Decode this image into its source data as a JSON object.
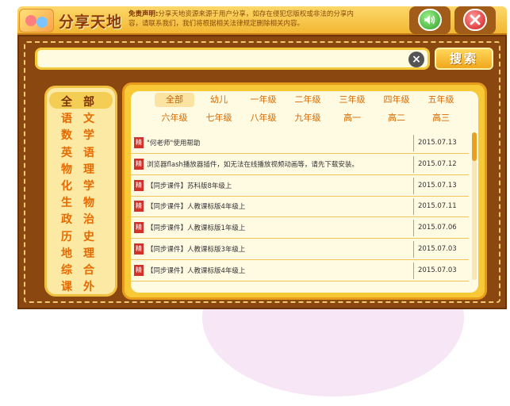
{
  "header": {
    "title": "分享天地",
    "disclaimer_label": "免责声明:",
    "disclaimer_text": "分享天地资源来源于用户分享，如存在侵犯您版权或非法的分享内容，请联系我们，我们将根据相关法律规定删除相关内容。"
  },
  "search": {
    "value": "",
    "button_label": "搜索"
  },
  "subjects": [
    [
      "全",
      "部"
    ],
    [
      "语",
      "文"
    ],
    [
      "数",
      "学"
    ],
    [
      "英",
      "语"
    ],
    [
      "物",
      "理"
    ],
    [
      "化",
      "学"
    ],
    [
      "生",
      "物"
    ],
    [
      "政",
      "治"
    ],
    [
      "历",
      "史"
    ],
    [
      "地",
      "理"
    ],
    [
      "综",
      "合"
    ],
    [
      "课",
      "外"
    ]
  ],
  "grades": [
    "全部",
    "幼儿",
    "一年级",
    "二年级",
    "三年级",
    "四年级",
    "五年级",
    "六年级",
    "七年级",
    "八年级",
    "九年级",
    "高一",
    "高二",
    "高三"
  ],
  "items": [
    {
      "tag": "精",
      "title": "\"何老师\"使用帮助",
      "date": "2015.07.13"
    },
    {
      "tag": "精",
      "title": "浏览器flash播放器插件，如无法在线播放视频动画等，请先下载安装。",
      "date": "2015.07.12"
    },
    {
      "tag": "精",
      "title": "【同步课件】苏科版8年级上",
      "date": "2015.07.13"
    },
    {
      "tag": "精",
      "title": "【同步课件】人教课标版4年级上",
      "date": "2015.07.11"
    },
    {
      "tag": "精",
      "title": "【同步课件】人教课标版1年级上",
      "date": "2015.07.06"
    },
    {
      "tag": "精",
      "title": "【同步课件】人教课标版3年级上",
      "date": "2015.07.03"
    },
    {
      "tag": "精",
      "title": "【同步课件】人教课标版4年级上",
      "date": "2015.07.03"
    }
  ],
  "colors": {
    "frame": "#8a4710",
    "accent": "#f8c836",
    "tag": "#d2322a"
  }
}
